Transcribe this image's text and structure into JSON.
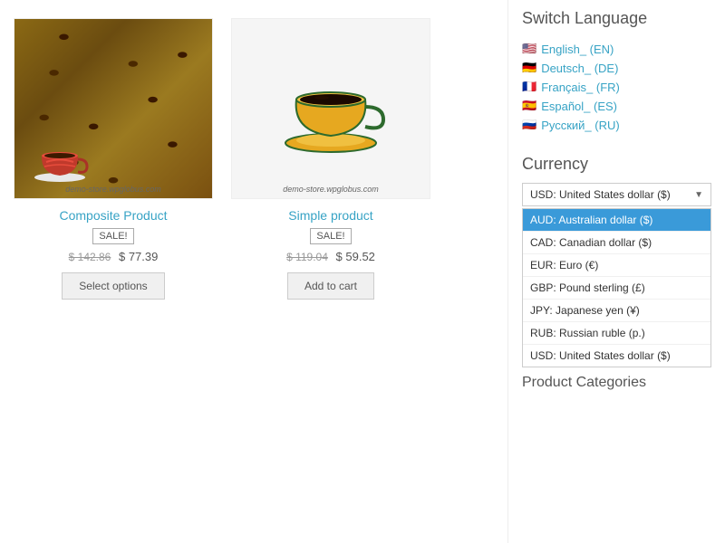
{
  "sidebar": {
    "switch_language_title": "Switch Language",
    "languages": [
      {
        "flag": "🇺🇸",
        "label": "English_ (EN)",
        "code": "EN"
      },
      {
        "flag": "🇩🇪",
        "label": "Deutsch_ (DE)",
        "code": "DE"
      },
      {
        "flag": "🇫🇷",
        "label": "Français_ (FR)",
        "code": "FR"
      },
      {
        "flag": "🇪🇸",
        "label": "Español_ (ES)",
        "code": "ES"
      },
      {
        "flag": "🇷🇺",
        "label": "Русский_ (RU)",
        "code": "RU"
      }
    ],
    "currency_title": "Currency",
    "currency_selected": "USD: United States dollar ($)",
    "currency_options": [
      {
        "value": "AUD",
        "label": "AUD: Australian dollar ($)",
        "selected": true
      },
      {
        "value": "CAD",
        "label": "CAD: Canadian dollar ($)",
        "selected": false
      },
      {
        "value": "EUR",
        "label": "EUR: Euro (€)",
        "selected": false
      },
      {
        "value": "GBP",
        "label": "GBP: Pound sterling (£)",
        "selected": false
      },
      {
        "value": "JPY",
        "label": "JPY: Japanese yen (¥)",
        "selected": false
      },
      {
        "value": "RUB",
        "label": "RUB: Russian ruble (р.)",
        "selected": false
      },
      {
        "value": "USD",
        "label": "USD: United States dollar ($)",
        "selected": false
      }
    ],
    "product_categories_title": "Product Categories"
  },
  "products": [
    {
      "title": "Composite Product",
      "badge": "SALE!",
      "price_old": "$ 142.86",
      "price_new": "$ 77.39",
      "action_label": "Select options",
      "watermark": "demo-store.wpglobus.com",
      "type": "beans"
    },
    {
      "title": "Simple product",
      "badge": "SALE!",
      "price_old": "$ 119.04",
      "price_new": "$ 59.52",
      "action_label": "Add to cart",
      "watermark": "demo-store.wpglobus.com",
      "type": "cup"
    }
  ]
}
